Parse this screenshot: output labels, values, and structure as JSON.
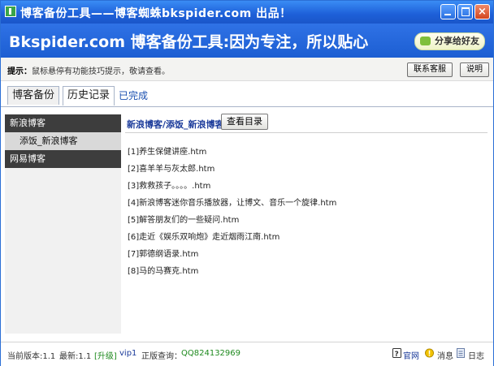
{
  "window": {
    "title": "博客备份工具——博客蜘蛛bkspider.com 出品！",
    "controls": [
      "minimize",
      "maximize",
      "close"
    ]
  },
  "banner": {
    "title": "Bkspider.com 博客备份工具:因为专注，所以贴心",
    "share_label": "分享给好友"
  },
  "tipbar": {
    "tip_label": "提示：",
    "tip_text": "鼠标悬停有功能技巧提示，敬请查看。",
    "contact_label": "联系客服",
    "help_label": "说明"
  },
  "tabs": [
    {
      "label": "博客备份",
      "active": false
    },
    {
      "label": "历史记录",
      "active": true
    }
  ],
  "status_link": "已完成",
  "sidebar": {
    "items": [
      {
        "label": "新浪博客",
        "kind": "group"
      },
      {
        "label": "添饭_新浪博客",
        "kind": "sub"
      },
      {
        "label": "网易博客",
        "kind": "group"
      }
    ]
  },
  "main": {
    "crumb": "新浪博客/添饭_新浪博客",
    "view_dir_label": "查看目录",
    "files": [
      "[1]养生保健讲座.htm",
      "[2]喜羊羊与灰太郎.htm",
      "[3]救救孩子。。。。.htm",
      "[4]新浪博客迷你音乐播放器，让博文、音乐一个旋律.htm",
      "[5]解答朋友们的一些疑问.htm",
      "[6]走近《娱乐双响炮》走近烟雨江南.htm",
      "[7]郭德纲语录.htm",
      "[8]马的马赛克.htm"
    ]
  },
  "statusbar": {
    "current_version": "当前版本:1.1",
    "latest_version": "最新:1.1",
    "upgrade": "[升级]",
    "vip": "vip1",
    "query_label": "正版查询：",
    "qq": "QQ824132969",
    "site": "官网",
    "message": "消息",
    "log": "日志"
  },
  "colors": {
    "titlebar": "#1d5fd8",
    "banner": "#2f72e6",
    "sidebar_group": "#3d3d3d",
    "link": "#1a4fb0",
    "green": "#1f8a1f"
  }
}
